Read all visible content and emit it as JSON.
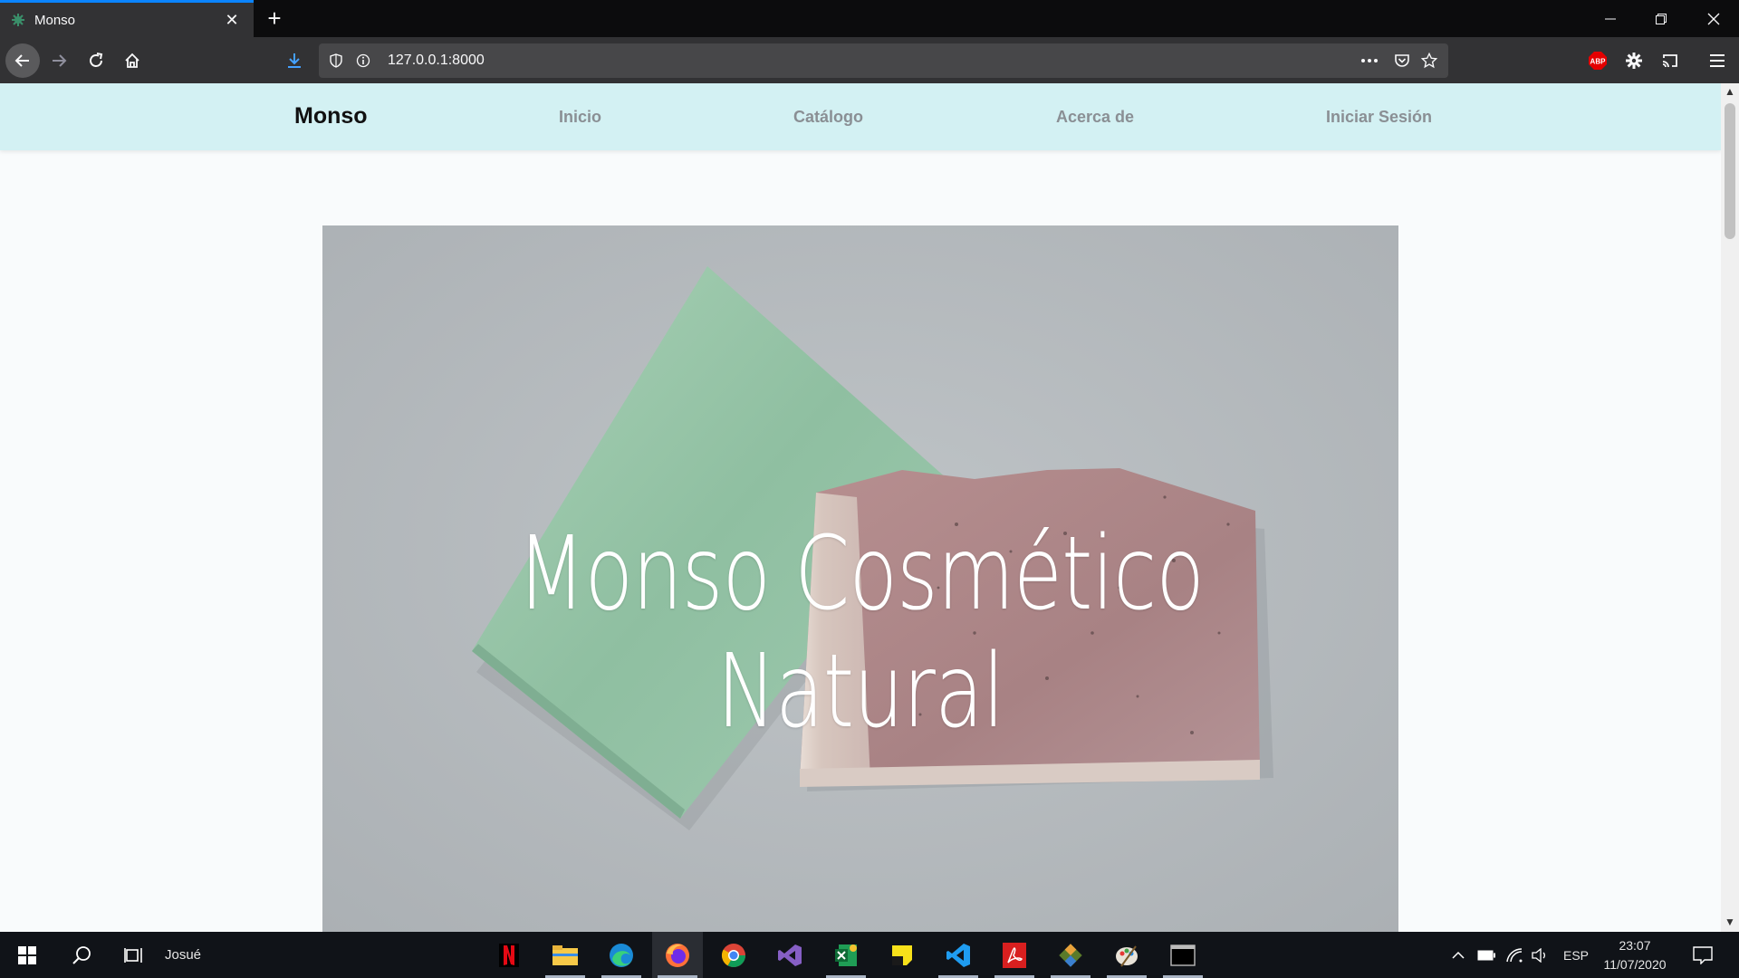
{
  "browser": {
    "tab_title": "Monso",
    "url": "127.0.0.1:8000",
    "new_tab_symbol": "+",
    "icons": [
      "back-icon",
      "forward-icon",
      "reload-icon",
      "home-icon",
      "download-icon",
      "shield-icon",
      "info-icon",
      "more-icon",
      "pocket-icon",
      "star-icon",
      "abp-icon",
      "extension-gear-icon",
      "cast-icon",
      "menu-icon"
    ],
    "abp_label": "ABP",
    "accent_color": "#0a84ff"
  },
  "site": {
    "brand": "Monso",
    "nav": {
      "inicio": "Inicio",
      "catalogo": "Catálogo",
      "acerca": "Acerca de",
      "login": "Iniciar Sesión"
    },
    "hero_title": "Monso Cosmético Natural",
    "nav_background": "#d3f1f3"
  },
  "taskbar": {
    "user": "Josué",
    "language": "ESP",
    "time": "23:07",
    "date": "11/07/2020",
    "apps": [
      "netflix-icon",
      "file-explorer-icon",
      "edge-icon",
      "firefox-icon",
      "chrome-icon",
      "visual-studio-icon",
      "excel-like-icon",
      "sticky-notes-icon",
      "vscode-icon",
      "acrobat-icon",
      "git-icon",
      "paint-icon",
      "terminal-icon"
    ]
  }
}
